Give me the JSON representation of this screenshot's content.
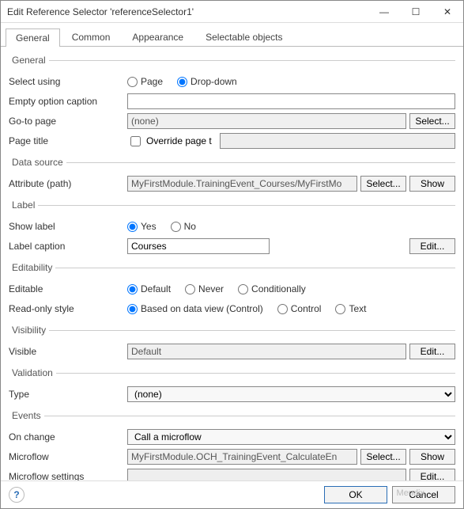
{
  "window": {
    "title": "Edit Reference Selector 'referenceSelector1'"
  },
  "tabs": [
    {
      "label": "General",
      "active": true
    },
    {
      "label": "Common",
      "active": false
    },
    {
      "label": "Appearance",
      "active": false
    },
    {
      "label": "Selectable objects",
      "active": false
    }
  ],
  "sections": {
    "general": {
      "legend": "General",
      "select_using_label": "Select using",
      "select_using_options": {
        "page": "Page",
        "dropdown": "Drop-down",
        "selected": "dropdown"
      },
      "empty_option_label": "Empty option caption",
      "empty_option_value": "",
      "goto_page_label": "Go-to page",
      "goto_page_value": "(none)",
      "select_btn": "Select...",
      "page_title_label": "Page title",
      "override_checkbox_label": "Override page t",
      "override_checked": false,
      "page_title_value": ""
    },
    "datasource": {
      "legend": "Data source",
      "attribute_label": "Attribute (path)",
      "attribute_value": "MyFirstModule.TrainingEvent_Courses/MyFirstMo",
      "select_btn": "Select...",
      "show_btn": "Show"
    },
    "label": {
      "legend": "Label",
      "show_label_label": "Show label",
      "show_options": {
        "yes": "Yes",
        "no": "No",
        "selected": "yes"
      },
      "caption_label": "Label caption",
      "caption_value": "Courses",
      "edit_btn": "Edit..."
    },
    "editability": {
      "legend": "Editability",
      "editable_label": "Editable",
      "editable_options": {
        "default": "Default",
        "never": "Never",
        "conditionally": "Conditionally",
        "selected": "default"
      },
      "readonly_label": "Read-only style",
      "readonly_options": {
        "based": "Based on data view (Control)",
        "control": "Control",
        "text": "Text",
        "selected": "based"
      }
    },
    "visibility": {
      "legend": "Visibility",
      "visible_label": "Visible",
      "visible_value": "Default",
      "edit_btn": "Edit..."
    },
    "validation": {
      "legend": "Validation",
      "type_label": "Type",
      "type_value": "(none)"
    },
    "events": {
      "legend": "Events",
      "onchange_label": "On change",
      "onchange_value": "Call a microflow",
      "microflow_label": "Microflow",
      "microflow_value": "MyFirstModule.OCH_TrainingEvent_CalculateEn",
      "select_btn": "Select...",
      "show_btn": "Show",
      "settings_label": "Microflow settings",
      "settings_value": "",
      "edit_btn": "Edit..."
    }
  },
  "footer": {
    "ok": "OK",
    "cancel": "Cancel"
  },
  "watermark": "Mendix"
}
